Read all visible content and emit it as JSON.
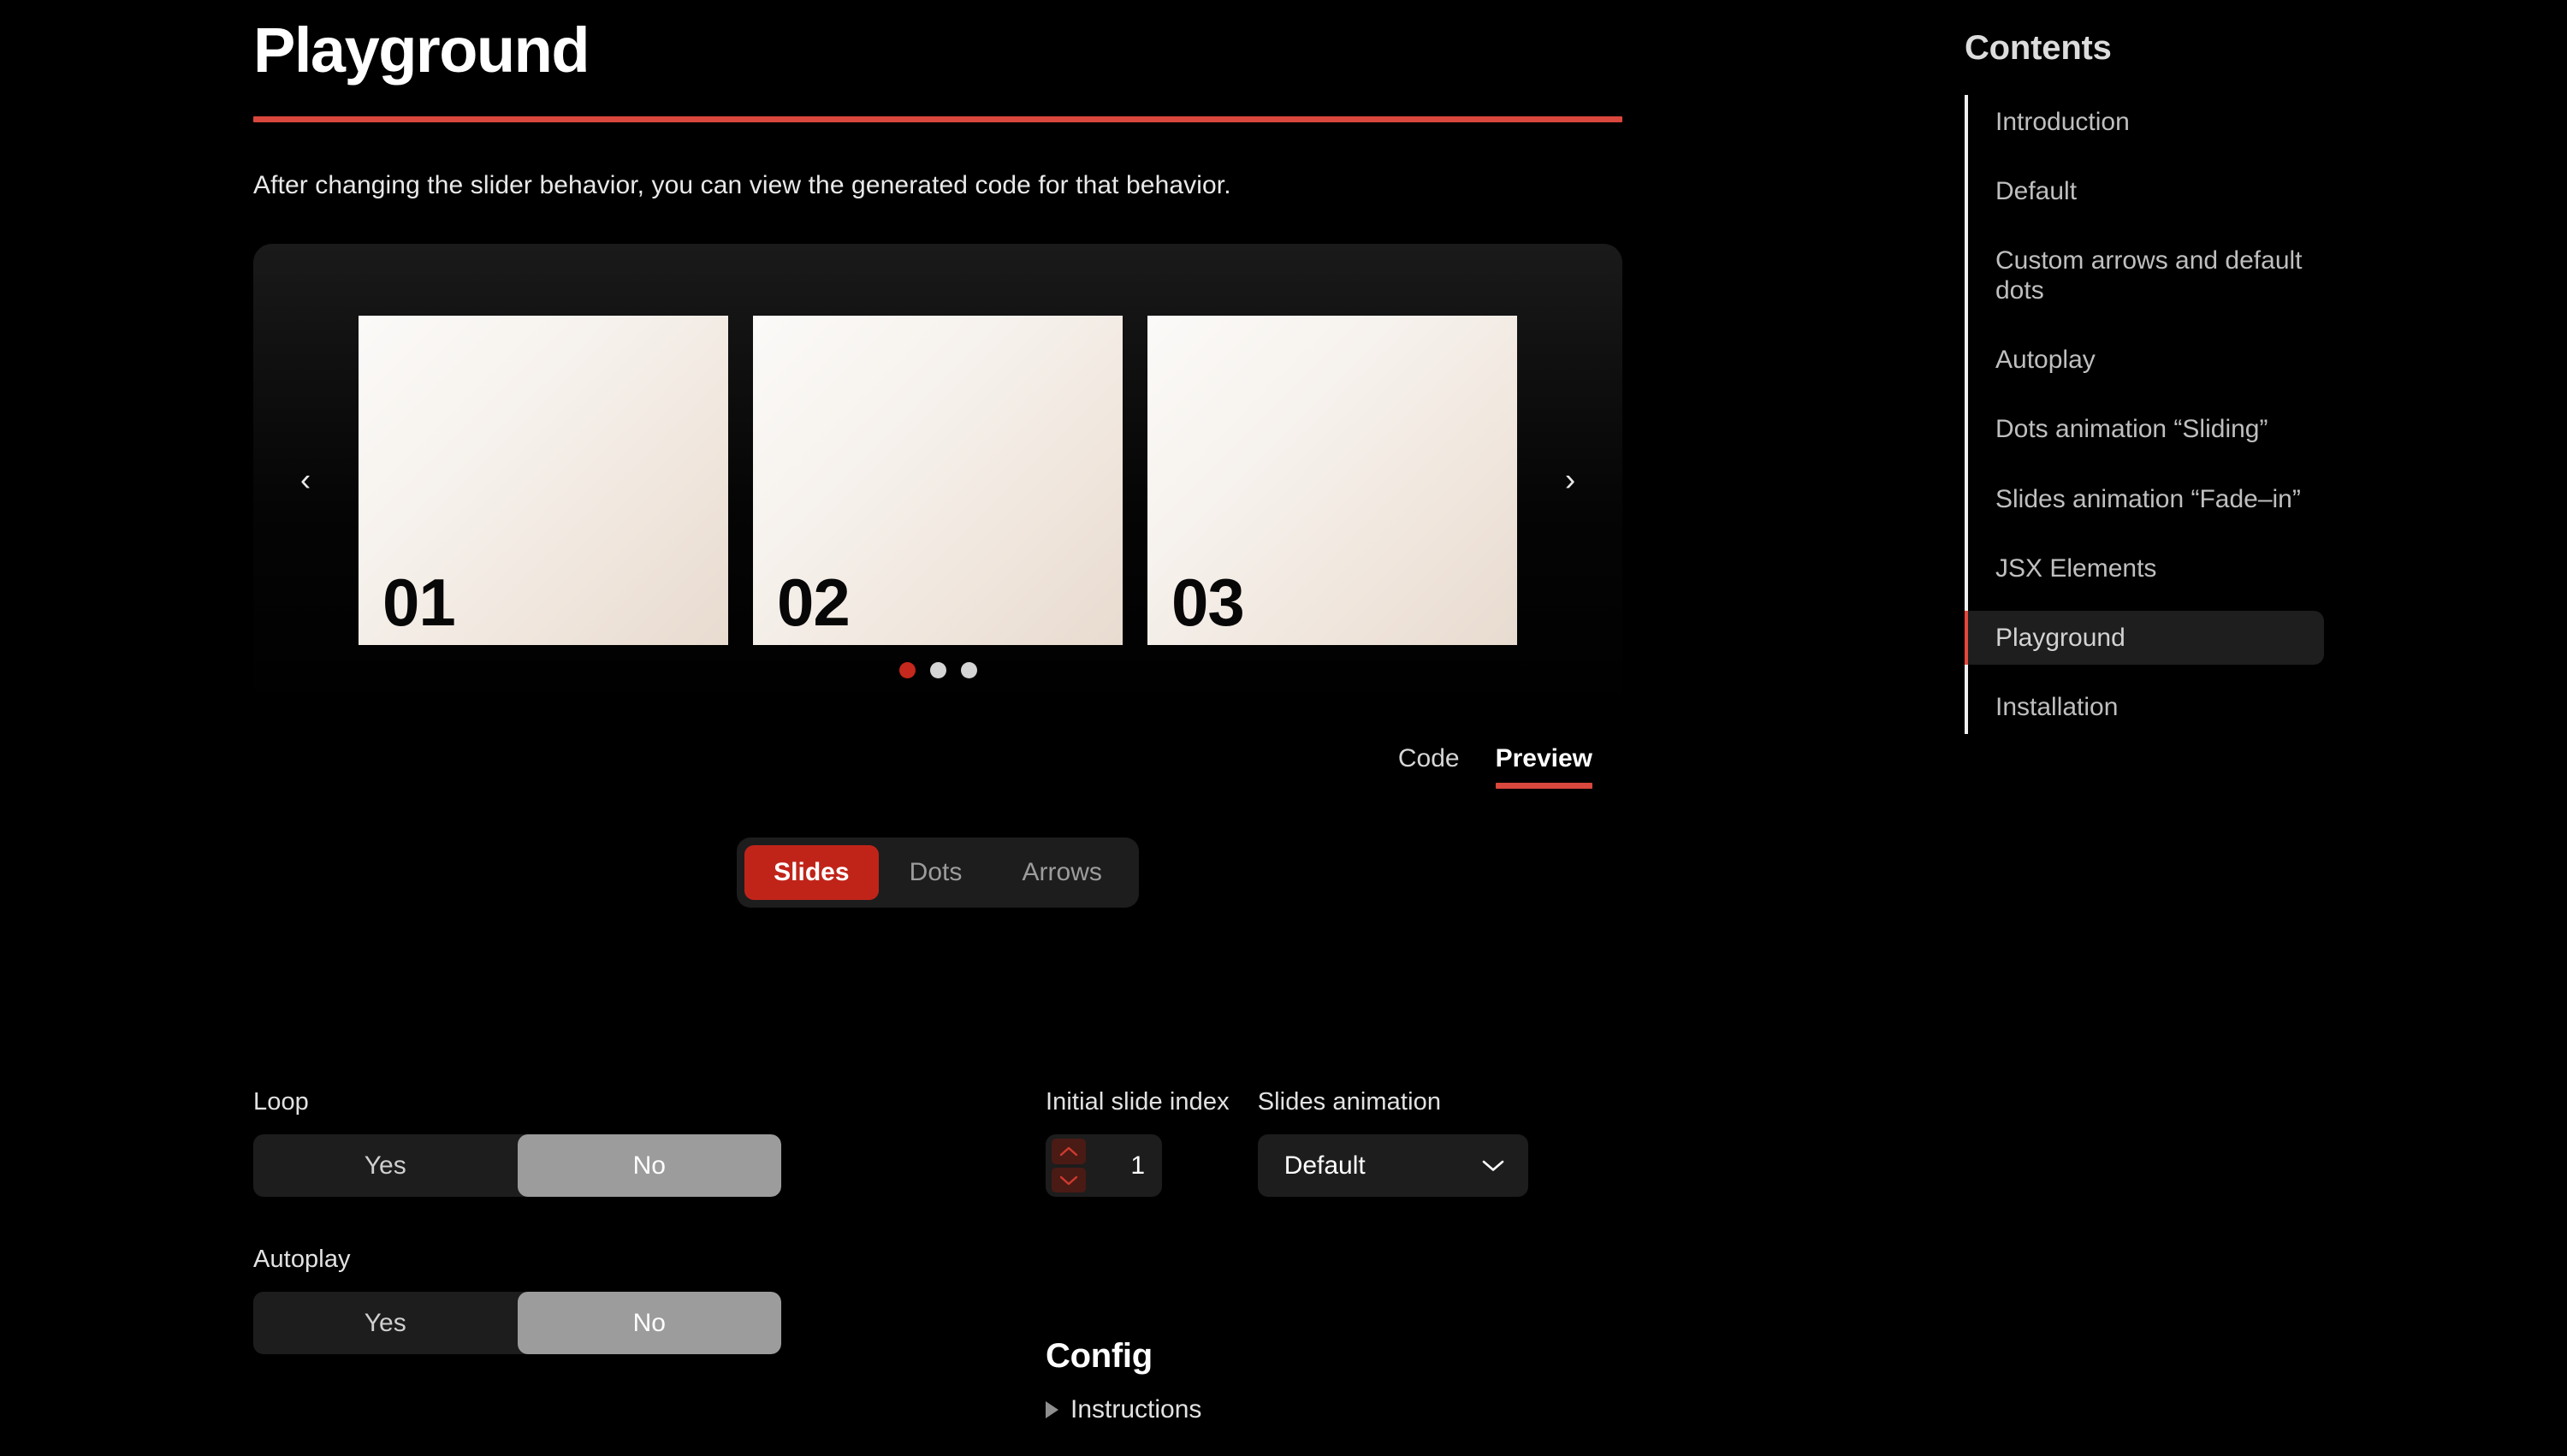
{
  "page": {
    "title": "Playground",
    "intro": "After changing the slider behavior, you can view the generated code for that behavior."
  },
  "carousel": {
    "prev_arrow": "‹",
    "next_arrow": "›",
    "slides": [
      {
        "label": "01"
      },
      {
        "label": "02"
      },
      {
        "label": "03"
      }
    ],
    "dots": [
      {
        "active": true
      },
      {
        "active": false
      },
      {
        "active": false
      }
    ],
    "active_dot_color": "#c5281c",
    "inactive_dot_color": "#d4d4d4"
  },
  "view_tabs": {
    "items": [
      {
        "label": "Code",
        "active": false
      },
      {
        "label": "Preview",
        "active": true
      }
    ],
    "active_underline_color": "#d9473d"
  },
  "segmented": {
    "items": [
      {
        "label": "Slides",
        "active": true
      },
      {
        "label": "Dots",
        "active": false
      },
      {
        "label": "Arrows",
        "active": false
      }
    ],
    "active_color": "#c02419"
  },
  "controls": {
    "loop": {
      "label": "Loop",
      "options": [
        {
          "label": "Yes",
          "selected": false
        },
        {
          "label": "No",
          "selected": true
        }
      ]
    },
    "autoplay": {
      "label": "Autoplay",
      "options": [
        {
          "label": "Yes",
          "selected": false
        },
        {
          "label": "No",
          "selected": true
        }
      ]
    },
    "initial_slide_index": {
      "label": "Initial slide index",
      "value": "1",
      "increment_icon": "chevron-up-icon",
      "decrement_icon": "chevron-down-icon"
    },
    "slides_animation": {
      "label": "Slides animation",
      "value": "Default",
      "caret_icon": "chevron-down-icon"
    }
  },
  "config": {
    "title": "Config",
    "instructions_label": "Instructions",
    "instructions_icon": "triangle-right-icon"
  },
  "toc": {
    "title": "Contents",
    "items": [
      {
        "label": "Introduction",
        "active": false
      },
      {
        "label": "Default",
        "active": false
      },
      {
        "label": "Custom arrows and default dots",
        "active": false
      },
      {
        "label": "Autoplay",
        "active": false
      },
      {
        "label": "Dots animation “Sliding”",
        "active": false
      },
      {
        "label": "Slides animation “Fade–in”",
        "active": false
      },
      {
        "label": "JSX Elements",
        "active": false
      },
      {
        "label": "Playground",
        "active": true
      },
      {
        "label": "Installation",
        "active": false
      }
    ],
    "active_marker_color": "#e2483c"
  }
}
